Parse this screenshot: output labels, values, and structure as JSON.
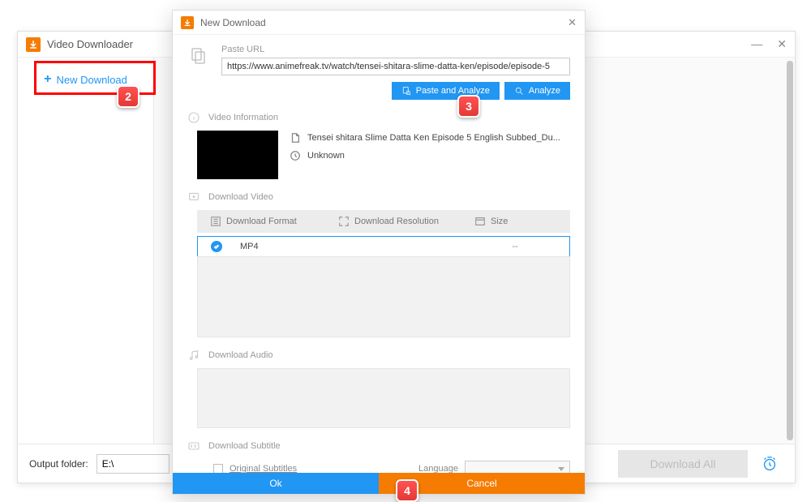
{
  "mainWindow": {
    "title": "Video Downloader",
    "newDownload": "New Download",
    "outputFolderLabel": "Output folder:",
    "outputFolderValue": "E:\\",
    "downloadAll": "Download All"
  },
  "dialog": {
    "title": "New Download",
    "pasteUrl": {
      "label": "Paste URL",
      "value": "https://www.animefreak.tv/watch/tensei-shitara-slime-datta-ken/episode/episode-5",
      "pasteAnalyze": "Paste and Analyze",
      "analyze": "Analyze"
    },
    "videoInfo": {
      "label": "Video Information",
      "title": "Tensei shitara Slime Datta Ken Episode 5 English Subbed_Du...",
      "duration": "Unknown"
    },
    "downloadVideo": {
      "label": "Download Video",
      "headers": {
        "format": "Download Format",
        "resolution": "Download Resolution",
        "size": "Size"
      },
      "rows": [
        {
          "format": "MP4",
          "resolution": "",
          "size": "--",
          "selected": true
        }
      ]
    },
    "downloadAudio": {
      "label": "Download Audio"
    },
    "subtitle": {
      "label": "Download Subtitle",
      "original": "Original Subtitles",
      "language": "Language"
    },
    "ok": "Ok",
    "cancel": "Cancel"
  },
  "annotations": {
    "a2": "2",
    "a3": "3",
    "a4": "4"
  }
}
